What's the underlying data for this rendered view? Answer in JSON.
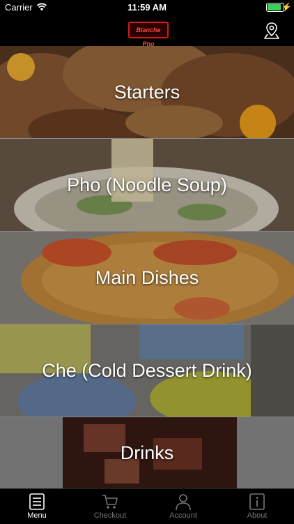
{
  "status_bar": {
    "carrier": "Carrier",
    "time": "11:59 AM"
  },
  "navbar": {
    "logo_text": "Blanche Pho",
    "right_icon": "map-pin-icon"
  },
  "menu": {
    "items": [
      {
        "label": "Starters"
      },
      {
        "label": "Pho (Noodle Soup)"
      },
      {
        "label": "Main Dishes"
      },
      {
        "label": "Che (Cold Dessert Drink)"
      },
      {
        "label": "Drinks"
      }
    ]
  },
  "tabbar": {
    "tabs": [
      {
        "label": "Menu",
        "icon": "menu-list-icon",
        "active": true
      },
      {
        "label": "Checkout",
        "icon": "cart-icon",
        "active": false
      },
      {
        "label": "Account",
        "icon": "user-icon",
        "active": false
      },
      {
        "label": "About",
        "icon": "info-icon",
        "active": false
      }
    ]
  },
  "colors": {
    "tab_active": "#ffffff",
    "tab_inactive": "#777777",
    "battery": "#3ed15a",
    "logo_border": "#d21b1b"
  }
}
